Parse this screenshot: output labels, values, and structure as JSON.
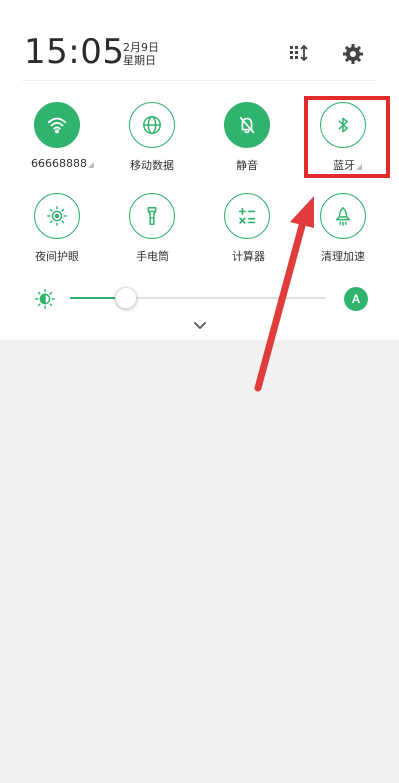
{
  "status": {
    "time": "15:05",
    "date": "2月9日",
    "weekday": "星期日"
  },
  "header_icons": [
    "grid-edit-icon",
    "gear-icon"
  ],
  "tiles": [
    {
      "label": "66668888",
      "icon": "wifi-icon",
      "active": true,
      "has_more": true
    },
    {
      "label": "移动数据",
      "icon": "globe-icon",
      "active": false,
      "has_more": false
    },
    {
      "label": "静音",
      "icon": "bell-off-icon",
      "active": true,
      "has_more": false
    },
    {
      "label": "蓝牙",
      "icon": "bluetooth-icon",
      "active": false,
      "has_more": true
    },
    {
      "label": "夜间护眼",
      "icon": "eye-icon",
      "active": false,
      "has_more": false
    },
    {
      "label": "手电筒",
      "icon": "flashlight-icon",
      "active": false,
      "has_more": false
    },
    {
      "label": "计算器",
      "icon": "calculator-icon",
      "active": false,
      "has_more": false
    },
    {
      "label": "清理加速",
      "icon": "rocket-icon",
      "active": false,
      "has_more": false
    }
  ],
  "brightness": {
    "level_percent": 22,
    "auto_label": "A"
  },
  "colors": {
    "accent": "#2fb36d",
    "highlight": "#e32b2b",
    "background": "#f1f1f1"
  }
}
